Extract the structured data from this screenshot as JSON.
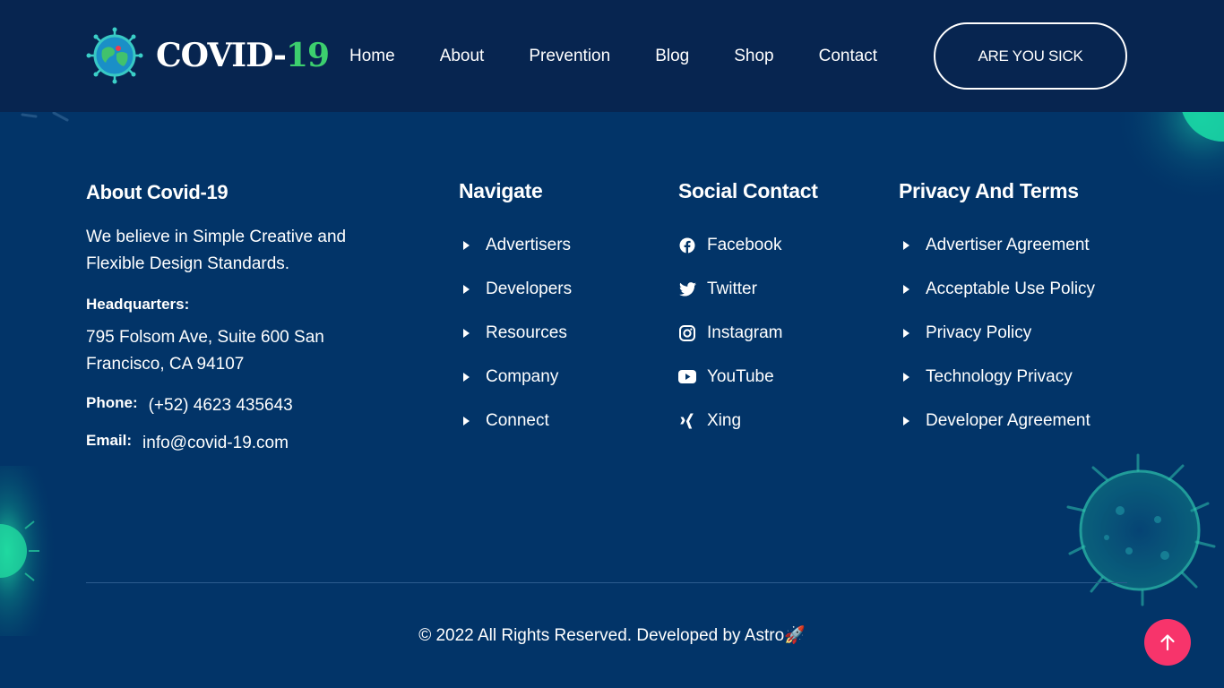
{
  "header": {
    "logo_main": "COVID-",
    "logo_num": "19",
    "nav": [
      "Home",
      "About",
      "Prevention",
      "Blog",
      "Shop",
      "Contact"
    ],
    "cta": "ARE YOU SICK"
  },
  "about": {
    "title": "About Covid-19",
    "text": "We believe in Simple Creative and Flexible Design Standards.",
    "hq_label": "Headquarters:",
    "hq_address": "795 Folsom Ave, Suite 600 San Francisco, CA 94107",
    "phone_label": "Phone:",
    "phone": "(+52) 4623 435643",
    "email_label": "Email:",
    "email": "info@covid-19.com"
  },
  "navigate": {
    "title": "Navigate",
    "items": [
      "Advertisers",
      "Developers",
      "Resources",
      "Company",
      "Connect"
    ]
  },
  "social": {
    "title": "Social Contact",
    "items": [
      {
        "label": "Facebook",
        "icon": "facebook-icon"
      },
      {
        "label": "Twitter",
        "icon": "twitter-icon"
      },
      {
        "label": "Instagram",
        "icon": "instagram-icon"
      },
      {
        "label": "YouTube",
        "icon": "youtube-icon"
      },
      {
        "label": "Xing",
        "icon": "xing-icon"
      }
    ]
  },
  "privacy": {
    "title": "Privacy And Terms",
    "items": [
      "Advertiser Agreement",
      "Acceptable Use Policy",
      "Privacy Policy",
      "Technology Privacy",
      "Developer Agreement"
    ]
  },
  "footer": {
    "copyright": "© 2022 All Rights Reserved. Developed by Astro🚀"
  },
  "colors": {
    "header_bg": "#072550",
    "footer_bg": "#023468",
    "accent_green": "#3ccf6e",
    "scroll_top": "#f7346b"
  }
}
